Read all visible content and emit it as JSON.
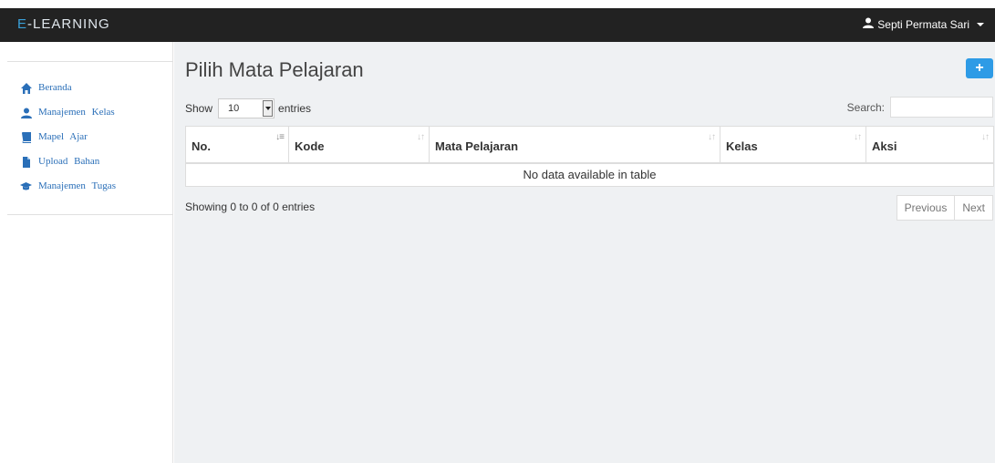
{
  "brand": {
    "first": "E",
    "rest": "-LEARNING"
  },
  "user": {
    "name": "Septi Permata Sari"
  },
  "sidebar": {
    "items": [
      {
        "label": "Beranda",
        "icon": "home-icon"
      },
      {
        "label": "Manajemen Kelas",
        "icon": "user-icon"
      },
      {
        "label": "Mapel Ajar",
        "icon": "book-icon"
      },
      {
        "label": "Upload Bahan",
        "icon": "file-icon"
      },
      {
        "label": "Manajemen Tugas",
        "icon": "graduation-cap-icon"
      }
    ]
  },
  "main": {
    "title": "Pilih Mata Pelajaran",
    "add_label": "+",
    "show_label": "Show",
    "entries_value": "10",
    "entries_label": "entries",
    "search_label": "Search:",
    "search_value": "",
    "columns": [
      "No.",
      "Kode",
      "Mata Pelajaran",
      "Kelas",
      "Aksi"
    ],
    "empty_text": "No data available in table",
    "info_text": "Showing 0 to 0 of 0 entries",
    "previous_label": "Previous",
    "next_label": "Next"
  },
  "colors": {
    "accent": "#2e9be6",
    "topbar": "#222222",
    "background": "#eff1f3",
    "link": "#2a6fb8"
  }
}
